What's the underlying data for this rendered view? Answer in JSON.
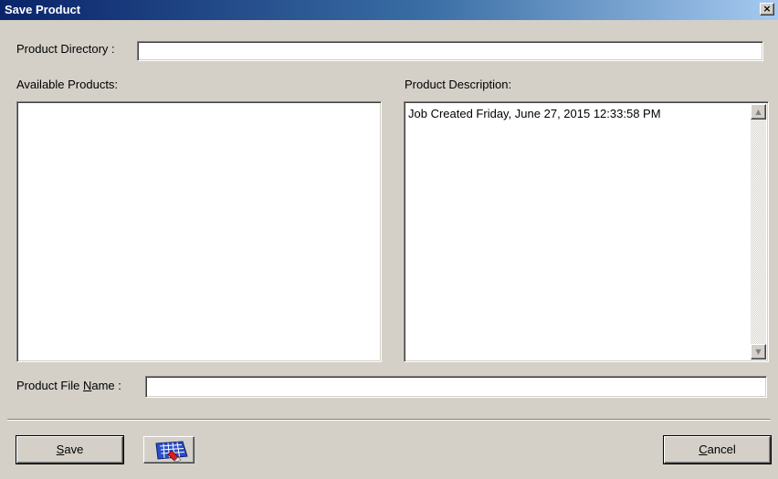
{
  "window": {
    "title": "Save Product",
    "close_glyph": "×"
  },
  "product_directory": {
    "label": "Product Directory :",
    "value": ""
  },
  "available_products": {
    "label": "Available Products:",
    "items": []
  },
  "product_description": {
    "label": "Product Description:",
    "text": "Job Created Friday, June 27, 2015 12:33:58 PM"
  },
  "product_file_name": {
    "label_pre": "Product File ",
    "label_mnemonic": "N",
    "label_post": "ame :",
    "value": ""
  },
  "buttons": {
    "save": {
      "mnemonic": "S",
      "rest": "ave"
    },
    "keyboard": {
      "icon": "keyboard-icon"
    },
    "cancel": {
      "mnemonic": "C",
      "rest": "ancel"
    }
  },
  "colors": {
    "titlebar_start": "#0a246a",
    "titlebar_end": "#a6caf0",
    "dialog_bg": "#d4d0c8"
  }
}
